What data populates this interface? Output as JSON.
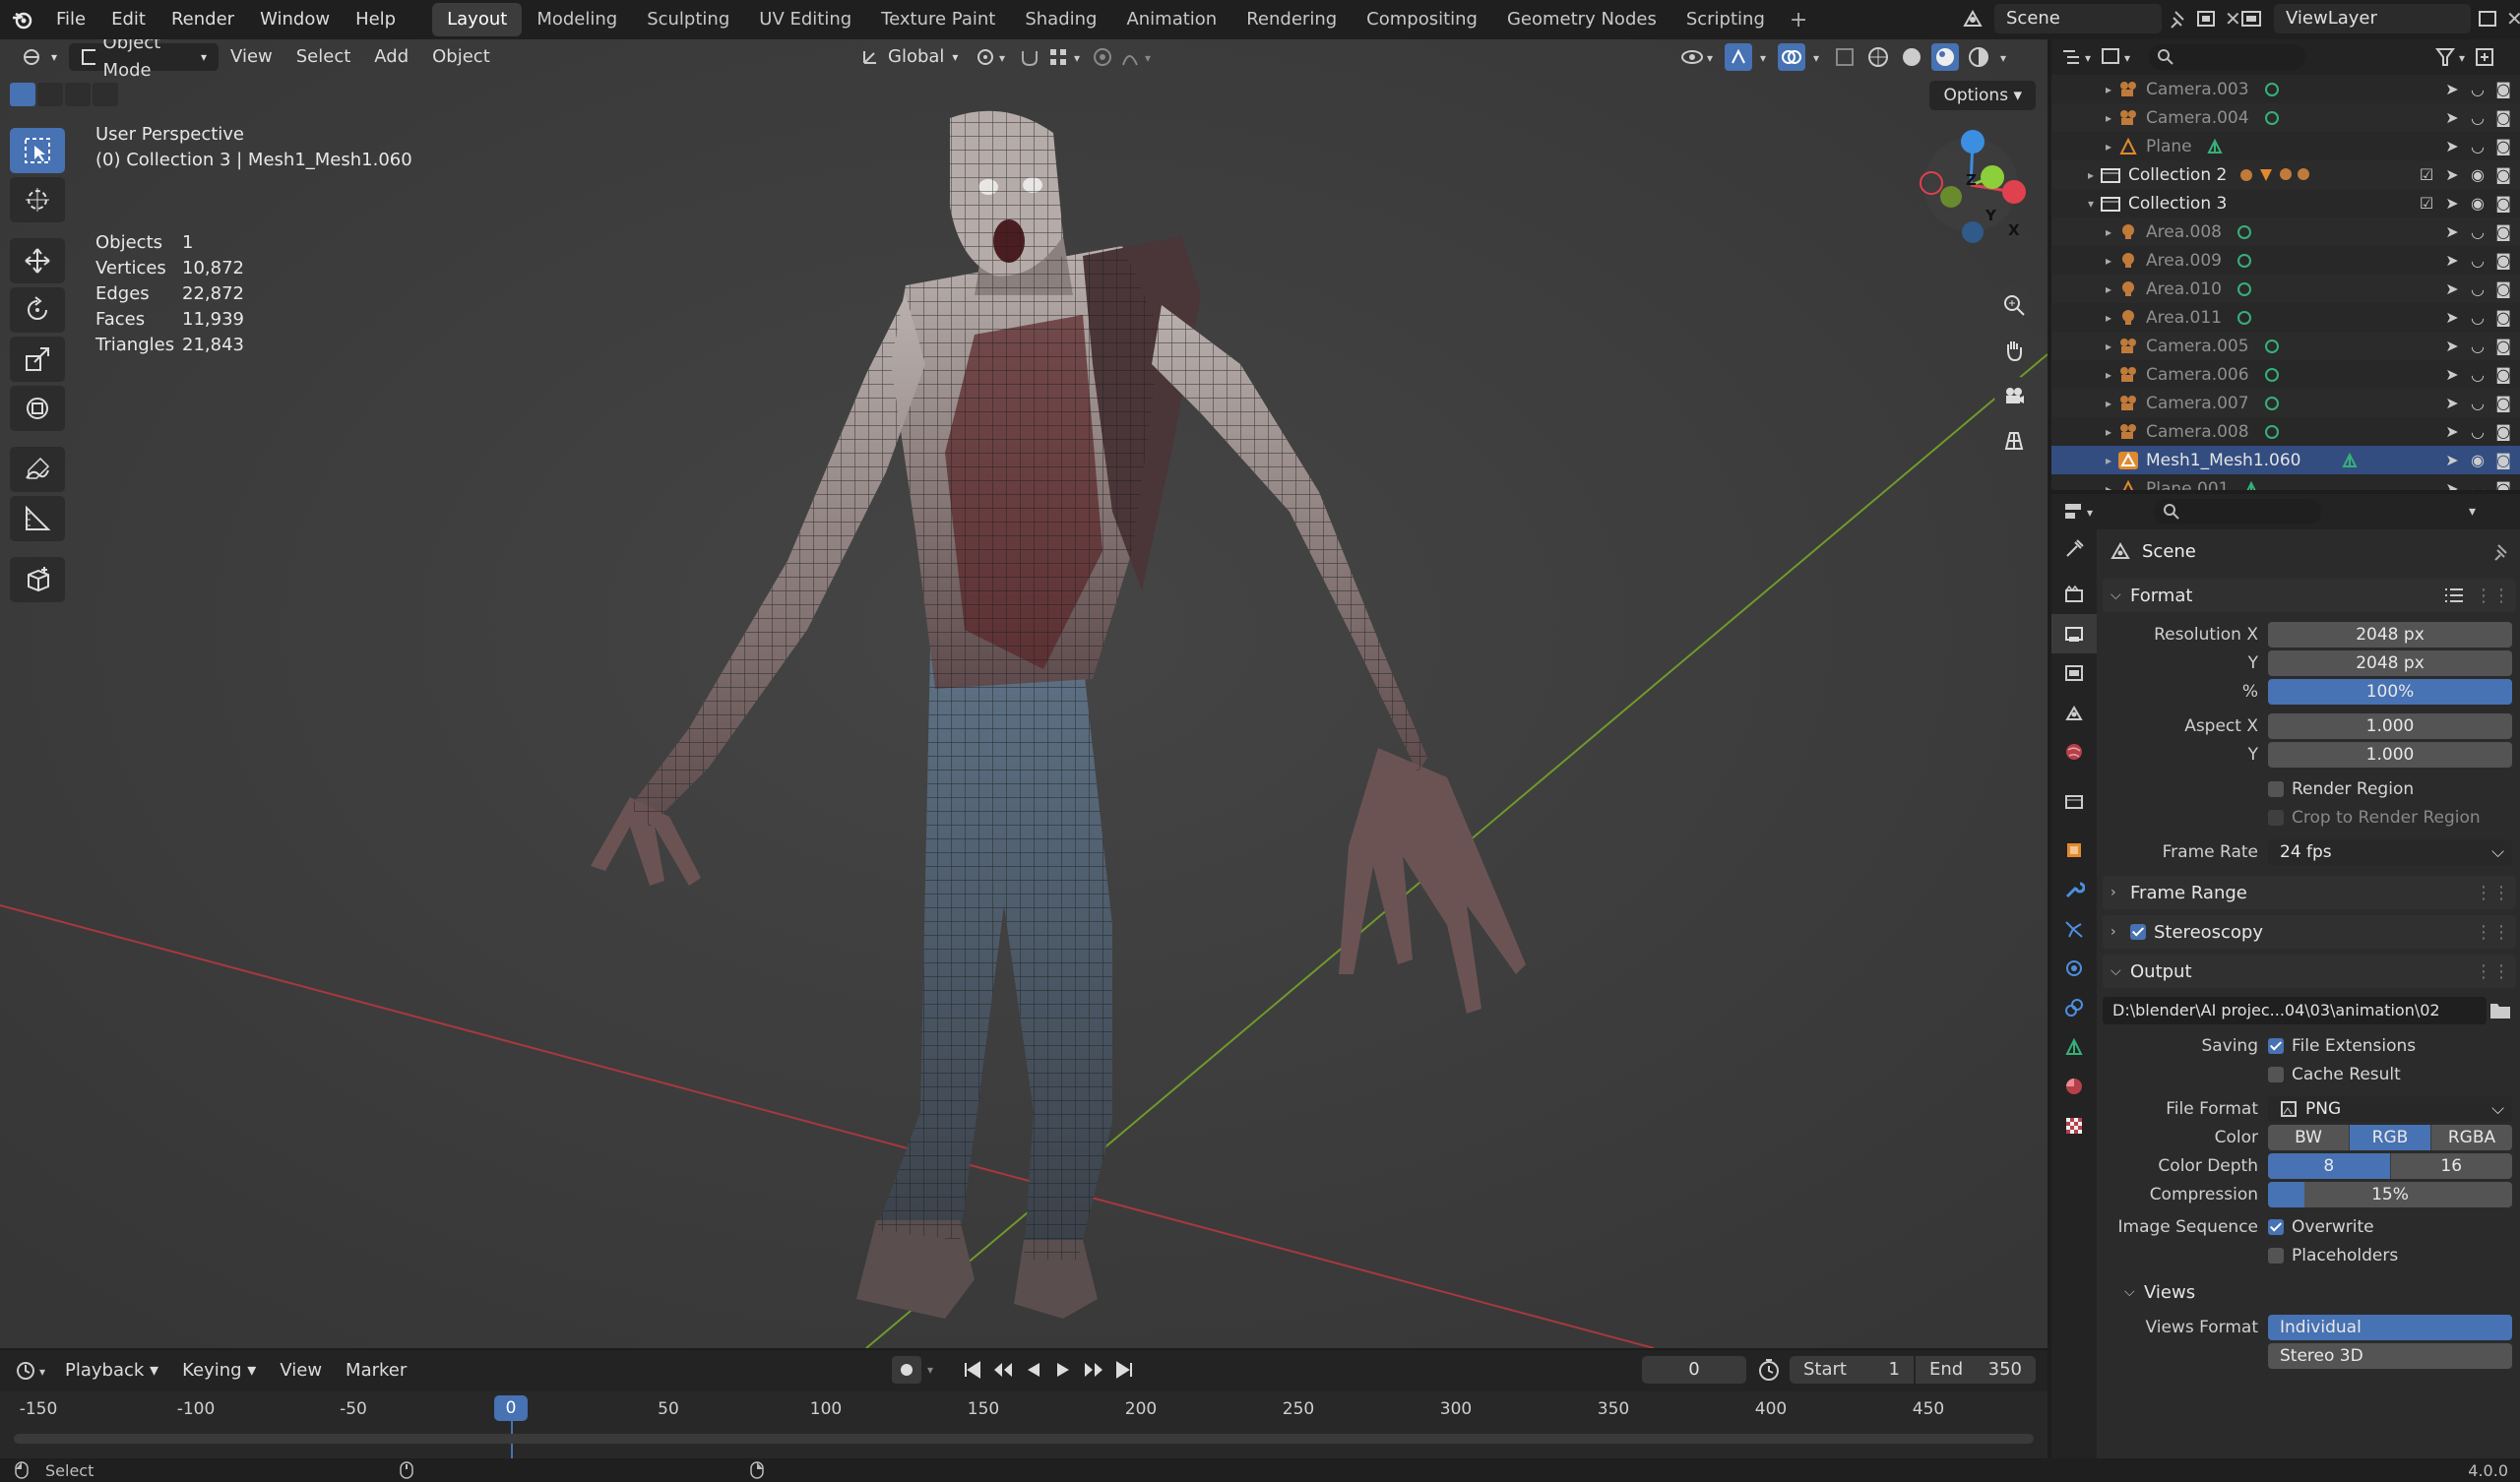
{
  "topbar": {
    "menus": [
      "File",
      "Edit",
      "Render",
      "Window",
      "Help"
    ],
    "workspaces": [
      "Layout",
      "Modeling",
      "Sculpting",
      "UV Editing",
      "Texture Paint",
      "Shading",
      "Animation",
      "Rendering",
      "Compositing",
      "Geometry Nodes",
      "Scripting"
    ],
    "active_workspace": "Layout",
    "scene": "Scene",
    "view_layer": "ViewLayer"
  },
  "viewport": {
    "mode": "Object Mode",
    "menus": [
      "View",
      "Select",
      "Add",
      "Object"
    ],
    "orientation": "Global",
    "options_label": "Options",
    "view_name": "User Perspective",
    "collection_info": "(0) Collection 3 | Mesh1_Mesh1.060",
    "stats": [
      {
        "label": "Objects",
        "value": "1"
      },
      {
        "label": "Vertices",
        "value": "10,872"
      },
      {
        "label": "Edges",
        "value": "22,872"
      },
      {
        "label": "Faces",
        "value": "11,939"
      },
      {
        "label": "Triangles",
        "value": "21,843"
      }
    ],
    "gizmo": {
      "z": "Z",
      "y": "Y",
      "x": "X"
    }
  },
  "outliner": {
    "rows": [
      {
        "name": "Camera.003",
        "type": "camera",
        "indent": 2,
        "strong": false
      },
      {
        "name": "Camera.004",
        "type": "camera",
        "indent": 2,
        "strong": false
      },
      {
        "name": "Plane",
        "type": "mesh",
        "indent": 2,
        "strong": false
      },
      {
        "name": "Collection 2",
        "type": "collection",
        "indent": 1,
        "strong": true,
        "open": false,
        "extra": "2 4 4"
      },
      {
        "name": "Collection 3",
        "type": "collection",
        "indent": 1,
        "strong": true,
        "open": true
      },
      {
        "name": "Area.008",
        "type": "light",
        "indent": 2,
        "strong": false
      },
      {
        "name": "Area.009",
        "type": "light",
        "indent": 2,
        "strong": false
      },
      {
        "name": "Area.010",
        "type": "light",
        "indent": 2,
        "strong": false
      },
      {
        "name": "Area.011",
        "type": "light",
        "indent": 2,
        "strong": false
      },
      {
        "name": "Camera.005",
        "type": "camera",
        "indent": 2,
        "strong": false
      },
      {
        "name": "Camera.006",
        "type": "camera",
        "indent": 2,
        "strong": false
      },
      {
        "name": "Camera.007",
        "type": "camera",
        "indent": 2,
        "strong": false
      },
      {
        "name": "Camera.008",
        "type": "camera",
        "indent": 2,
        "strong": false
      },
      {
        "name": "Mesh1_Mesh1.060",
        "type": "mesh-selected",
        "indent": 2,
        "strong": true
      },
      {
        "name": "Plane.001",
        "type": "mesh",
        "indent": 2,
        "strong": false
      }
    ]
  },
  "properties": {
    "context": "Scene",
    "format": {
      "title": "Format",
      "resolution_x_label": "Resolution X",
      "resolution_x": "2048 px",
      "y_label": "Y",
      "resolution_y": "2048 px",
      "pct_label": "%",
      "pct": "100%",
      "aspect_x_label": "Aspect X",
      "aspect_x": "1.000",
      "aspect_y": "1.000",
      "render_region": "Render Region",
      "crop_region": "Crop to Render Region",
      "frame_rate_label": "Frame Rate",
      "frame_rate": "24 fps"
    },
    "frame_range": "Frame Range",
    "stereoscopy": "Stereoscopy",
    "output": {
      "title": "Output",
      "path": "D:\\blender\\AI projec...04\\03\\animation\\02",
      "saving_label": "Saving",
      "file_extensions": "File Extensions",
      "cache_result": "Cache Result",
      "file_format_label": "File Format",
      "file_format": "PNG",
      "color_label": "Color",
      "color_opts": [
        "BW",
        "RGB",
        "RGBA"
      ],
      "color_sel": "RGB",
      "depth_label": "Color Depth",
      "depth_opts": [
        "8",
        "16"
      ],
      "compression_label": "Compression",
      "compression": "15%",
      "compression_fraction": 0.15,
      "image_seq_label": "Image Sequence",
      "overwrite": "Overwrite",
      "placeholders": "Placeholders"
    },
    "views": {
      "title": "Views",
      "format_label": "Views Format",
      "individual": "Individual",
      "stereo": "Stereo 3D"
    }
  },
  "timeline": {
    "menus": [
      "Playback",
      "Keying",
      "View",
      "Marker"
    ],
    "current_frame": "0",
    "start_label": "Start",
    "start": "1",
    "end_label": "End",
    "end": "350",
    "ticks": [
      "-150",
      "-100",
      "-50",
      "0",
      "50",
      "100",
      "150",
      "200",
      "250",
      "300",
      "350",
      "400",
      "450"
    ]
  },
  "statusbar": {
    "left": "Select",
    "version": "4.0.0"
  },
  "colors": {
    "accent": "#4772b3",
    "x_axis": "#e0414e",
    "y_axis": "#8ccf3a",
    "z_axis": "#3c8fe0"
  }
}
